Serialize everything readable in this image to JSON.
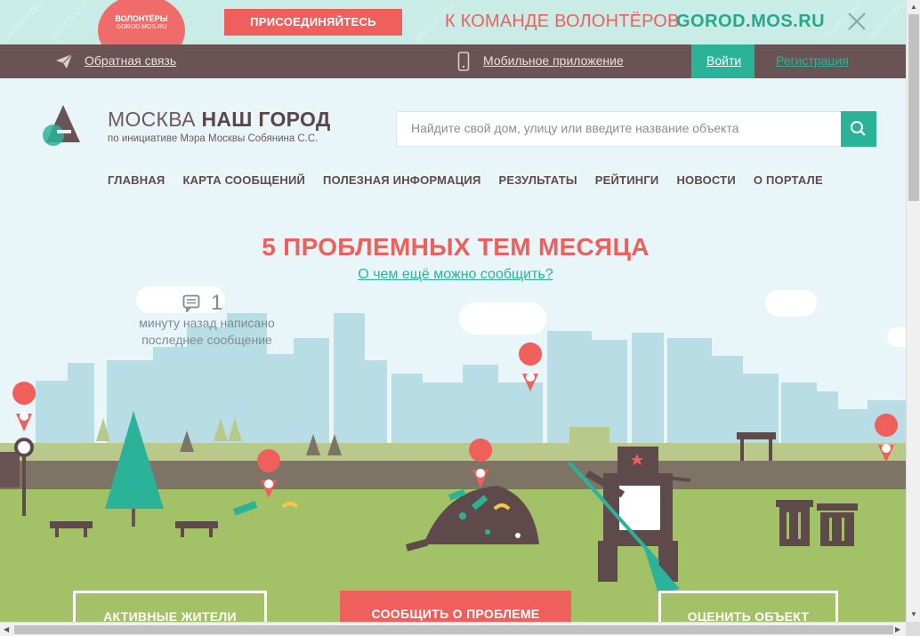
{
  "banner": {
    "badge_line1": "ВОЛОНТЁРЫ",
    "badge_line2": "GOROD.MOS.RU",
    "join_label": "ПРИСОЕДИНЯЙТЕСЬ",
    "text": "К КОМАНДЕ ВОЛОНТЁРОВ",
    "site": "GOROD.MOS.RU",
    "close_icon": "close-icon"
  },
  "topbar": {
    "feedback_label": "Обратная связь",
    "mobile_label": "Мобильное приложение",
    "login_label": "Войти",
    "register_label": "Регистрация",
    "colors": {
      "bar": "#6a5354",
      "accent": "#2bb399"
    }
  },
  "header": {
    "title_light": "МОСКВА",
    "title_bold": "НАШ ГОРОД",
    "subtitle": "по инициативе Мэра Москвы Собянина С.С.",
    "search_placeholder": "Найдите свой дом, улицу или введите название объекта"
  },
  "nav": {
    "items": [
      {
        "label": "ГЛАВНАЯ"
      },
      {
        "label": "КАРТА СООБЩЕНИЙ"
      },
      {
        "label": "ПОЛЕЗНАЯ ИНФОРМАЦИЯ"
      },
      {
        "label": "РЕЗУЛЬТАТЫ"
      },
      {
        "label": "РЕЙТИНГИ"
      },
      {
        "label": "НОВОСТИ"
      },
      {
        "label": "О ПОРТАЛЕ"
      }
    ]
  },
  "hero": {
    "headline": "5 ПРОБЛЕМНЫХ ТЕМ МЕСЯЦА",
    "subhead": "О чем ещё можно сообщить?",
    "message_count": "1",
    "message_text": "минуту назад написано последнее сообщение"
  },
  "actions": {
    "active_residents": "АКТИВНЫЕ ЖИТЕЛИ",
    "report_problem": "СООБЩИТЬ О ПРОБЛЕМЕ",
    "rate_object": "ОЦЕНИТЬ ОБЪЕКТ"
  },
  "colors": {
    "brand_red": "#ef5f5b",
    "brand_green": "#2bb399",
    "sky": "#e8f5f9",
    "grass": "#a3c167"
  }
}
